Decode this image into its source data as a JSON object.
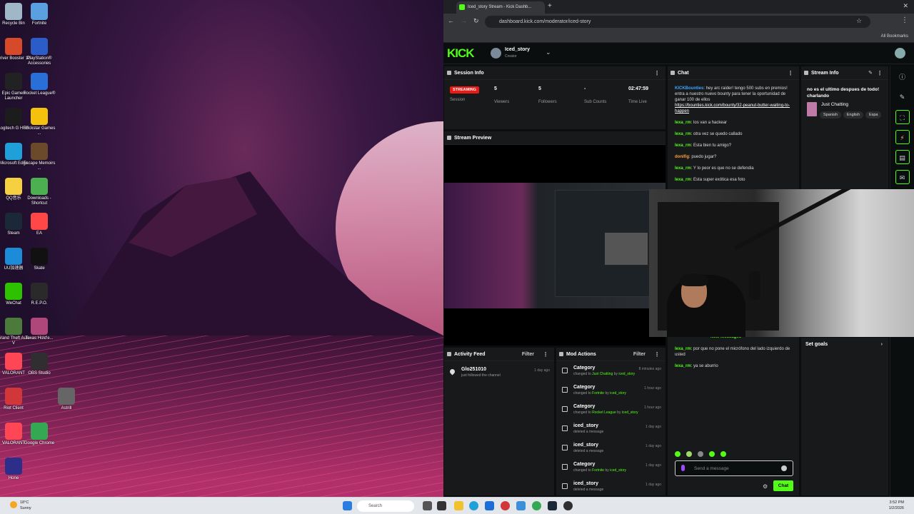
{
  "desktop": {
    "icons": [
      {
        "label": "Recycle Bin",
        "color": "#9fb7c7"
      },
      {
        "label": "Fortnite",
        "color": "#5aa0e0"
      },
      {
        "label": "Driver Booster 12",
        "color": "#d64a2a"
      },
      {
        "label": "PlayStation® Accessories",
        "color": "#2b5dc9"
      },
      {
        "label": "Epic Games Launcher",
        "color": "#222222"
      },
      {
        "label": "Rocket League®",
        "color": "#2a6ed8"
      },
      {
        "label": "Logitech G HUB",
        "color": "#1c1c1c"
      },
      {
        "label": "Rockstar Games ...",
        "color": "#f4c20d"
      },
      {
        "label": "Microsoft Edge",
        "color": "#1fa0d8"
      },
      {
        "label": "Escape Memoirs ...",
        "color": "#6a4a2a"
      },
      {
        "label": "QQ音乐",
        "color": "#f5d142"
      },
      {
        "label": "Downloads - Shortcut",
        "color": "#4caf50"
      },
      {
        "label": "Steam",
        "color": "#1b2838"
      },
      {
        "label": "EA",
        "color": "#ff4747"
      },
      {
        "label": "UU加速器",
        "color": "#1c8bd8"
      },
      {
        "label": "Skate",
        "color": "#111111"
      },
      {
        "label": "WeChat",
        "color": "#2dc100"
      },
      {
        "label": "R.E.P.O.",
        "color": "#2a2a2a"
      },
      {
        "label": "Grand Theft Auto V",
        "color": "#4c7a3a"
      },
      {
        "label": "Texas Hold'e...",
        "color": "#b0477a"
      },
      {
        "label": "VALORANT",
        "color": "#ff4655"
      },
      {
        "label": "OBS Studio",
        "color": "#302e31"
      },
      {
        "label": "Riot Client",
        "color": "#d13639"
      },
      {
        "label": "Astrill",
        "color": "#666666"
      },
      {
        "label": "VALORANT",
        "color": "#ff4655"
      },
      {
        "label": "Google Chrome",
        "color": "#34a853"
      },
      {
        "label": "Hone",
        "color": "#2d2d8a"
      }
    ]
  },
  "browser": {
    "tab_title": "Iced_story Stream - Kick Dashb...",
    "url": "dashboard.kick.com/moderator/iced-story",
    "bookmarks_label": "All Bookmarks"
  },
  "kick": {
    "logo": "KICK",
    "channel_name": "Iced_story",
    "channel_role": "Creator"
  },
  "session": {
    "title": "Session Info",
    "status_badge": "STREAMING",
    "status_label": "Session",
    "viewers_value": "5",
    "viewers_label": "Viewers",
    "followers_value": "5",
    "followers_label": "Followers",
    "subs_value": "-",
    "subs_label": "Sub Counts",
    "time_value": "02:47:59",
    "time_label": "Time Live"
  },
  "preview": {
    "title": "Stream Preview"
  },
  "chat": {
    "title": "Chat",
    "pinned_user": "KICKBounties",
    "pinned_text": "hey arc raider! tengo 500 subs en premios! entra a nuestro nuevo bounty para tener la oportunidad de ganar 100 de ellos",
    "pinned_link": "https://bounties.kick.com/bounty/32-peanut-butter-waiting-to-happen",
    "messages": [
      {
        "user": "lexa_rm",
        "text": "los van a hackear"
      },
      {
        "user": "lexa_rm",
        "text": "otra vez se quedo callado"
      },
      {
        "user": "lexa_rm",
        "text": "Esta bien tu amigo?"
      },
      {
        "user": "donifig",
        "text": "puedo jugar?"
      },
      {
        "user": "lexa_rm",
        "text": "Y lo peor es que no se defendia"
      },
      {
        "user": "lexa_rm",
        "text": "Esta super exótica esa foto"
      }
    ],
    "new_messages": "New messages",
    "messages_after": [
      {
        "user": "lexa_rm",
        "text": "por que no pone el micrófono del lado izquierdo de usted"
      },
      {
        "user": "lexa_rm",
        "text": "ya se aburrio"
      }
    ],
    "input_placeholder": "Send a message",
    "send_button": "Chat"
  },
  "stream_info": {
    "title": "Stream Info",
    "stream_title": "no es el ultimo despues de todo! charlando",
    "category": "Just Chatting",
    "tags": [
      "Spanish",
      "English",
      "Espa"
    ]
  },
  "goals": {
    "title": "Set goals"
  },
  "activity": {
    "title": "Activity Feed",
    "filter": "Filter",
    "items": [
      {
        "user": "Glo251010",
        "text": "just followed the channel",
        "time": "1 day ago"
      }
    ]
  },
  "mod_actions": {
    "title": "Mod Actions",
    "filter": "Filter",
    "items": [
      {
        "title": "Category",
        "pre": "changed to",
        "target": "Just Chatting",
        "mid": "by",
        "by": "iced_story",
        "time": "8 minutes ago"
      },
      {
        "title": "Category",
        "pre": "changed to",
        "target": "Fortnite",
        "mid": "by",
        "by": "iced_story",
        "time": "1 hour ago"
      },
      {
        "title": "Category",
        "pre": "changed to",
        "target": "Rocket League",
        "mid": "by",
        "by": "iced_story",
        "time": "1 hour ago"
      },
      {
        "title": "iced_story",
        "pre": "deleted a message",
        "target": "",
        "mid": "",
        "by": "",
        "time": "1 day ago"
      },
      {
        "title": "iced_story",
        "pre": "deleted a message",
        "target": "",
        "mid": "",
        "by": "",
        "time": "1 day ago"
      },
      {
        "title": "Category",
        "pre": "changed to",
        "target": "Fortnite",
        "mid": "by",
        "by": "iced_story",
        "time": "1 day ago"
      },
      {
        "title": "iced_story",
        "pre": "deleted a message",
        "target": "",
        "mid": "",
        "by": "",
        "time": "1 day ago"
      }
    ]
  },
  "taskbar": {
    "search": "Search",
    "weather_temp": "18°C",
    "weather_desc": "Sunny",
    "time": "3:52 PM",
    "date": "1/2/2026"
  },
  "colors": {
    "kick_green": "#53fc18",
    "panel": "#18191b",
    "live_red": "#e91916"
  }
}
